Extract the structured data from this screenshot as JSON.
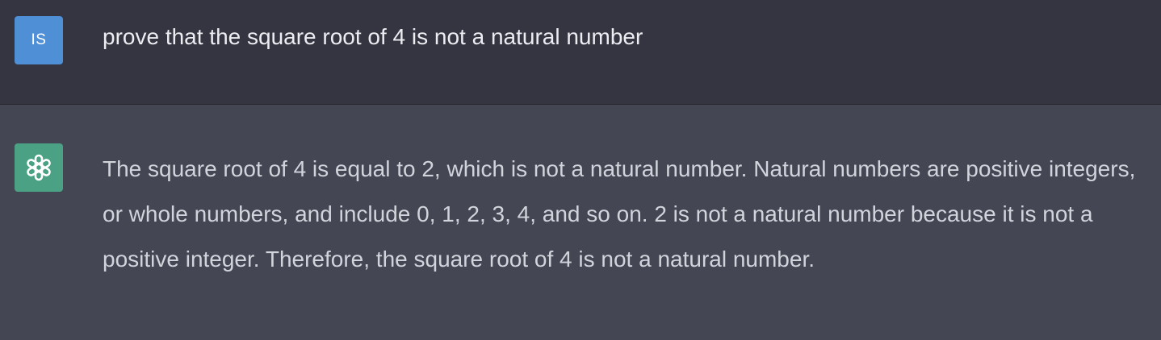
{
  "user_message": {
    "avatar_initials": "IS",
    "text": "prove that the square root of 4 is not a natural number"
  },
  "assistant_message": {
    "avatar_icon": "openai-logo-icon",
    "text": "The square root of 4 is equal to 2, which is not a natural number. Natural numbers are positive integers, or whole numbers, and include 0, 1, 2, 3, 4, and so on. 2 is not a natural number because it is not a positive integer. Therefore, the square root of 4 is not a natural number."
  },
  "colors": {
    "user_bg": "#343541",
    "assistant_bg": "#444654",
    "user_avatar": "#4f8fd6",
    "assistant_avatar": "#4aa183"
  }
}
